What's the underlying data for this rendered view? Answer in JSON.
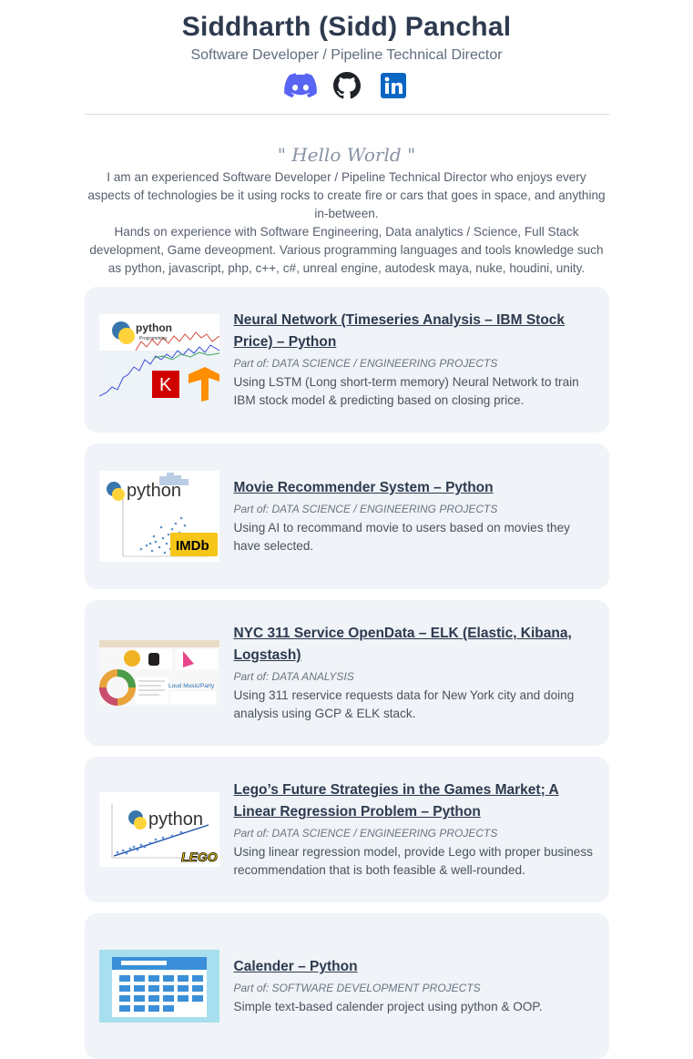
{
  "header": {
    "name": "Siddharth (Sidd) Panchal",
    "role": "Software Developer / Pipeline Technical Director",
    "social": [
      {
        "icon": "discord-icon",
        "color": "#5865f2"
      },
      {
        "icon": "github-icon",
        "color": "#1f2328"
      },
      {
        "icon": "linkedin-icon",
        "color": "#0a66c2"
      }
    ]
  },
  "intro": {
    "greeting": "\" Hello World \"",
    "paragraph1": "I am an experienced Software Developer / Pipeline Technical Director who enjoys every aspects of technologies be it using rocks to create fire or cars that goes in space, and anything in-between.",
    "paragraph2": "Hands on experience with Software Engineering, Data analytics / Science, Full Stack development, Game deveopment. Various programming languages and tools knowledge such as python, javascript, php, c++, c#, unreal engine, autodesk maya, nuke, houdini, unity."
  },
  "projects": [
    {
      "title": "Neural Network (Timeseries Analysis – IBM Stock Price) – Python",
      "category": "Part of: DATA SCIENCE / ENGINEERING PROJECTS",
      "description": "Using LSTM (Long short-term memory) Neural Network to train IBM stock model & predicting based on closing price.",
      "thumb_label": "python",
      "thumb_sub": "Programming",
      "thumb_badge": "K"
    },
    {
      "title": "Movie Recommender System – Python",
      "category": "Part of: DATA SCIENCE / ENGINEERING PROJECTS",
      "description": "Using AI to recommand movie to users based on movies they have selected.",
      "thumb_label": "python",
      "thumb_badge": "IMDb"
    },
    {
      "title": "NYC 311 Service OpenData – ELK (Elastic, Kibana, Logstash)",
      "category": "Part of: DATA ANALYSIS",
      "description": "Using 311 reservice requests data for New York city and doing analysis using GCP & ELK stack.",
      "thumb_label": "Loud Music/Party"
    },
    {
      "title": "Lego’s Future Strategies in the Games Market; A Linear Regression Problem – Python",
      "category": "Part of: DATA SCIENCE / ENGINEERING PROJECTS",
      "description": "Using linear regression model, provide Lego with proper business recommendation that is both feasible & well-rounded.",
      "thumb_label": "python",
      "thumb_badge": "LEGO"
    },
    {
      "title": "Calender – Python",
      "category": "Part of: SOFTWARE DEVELOPMENT PROJECTS",
      "description": "Simple text-based calender project using python & OOP."
    }
  ]
}
